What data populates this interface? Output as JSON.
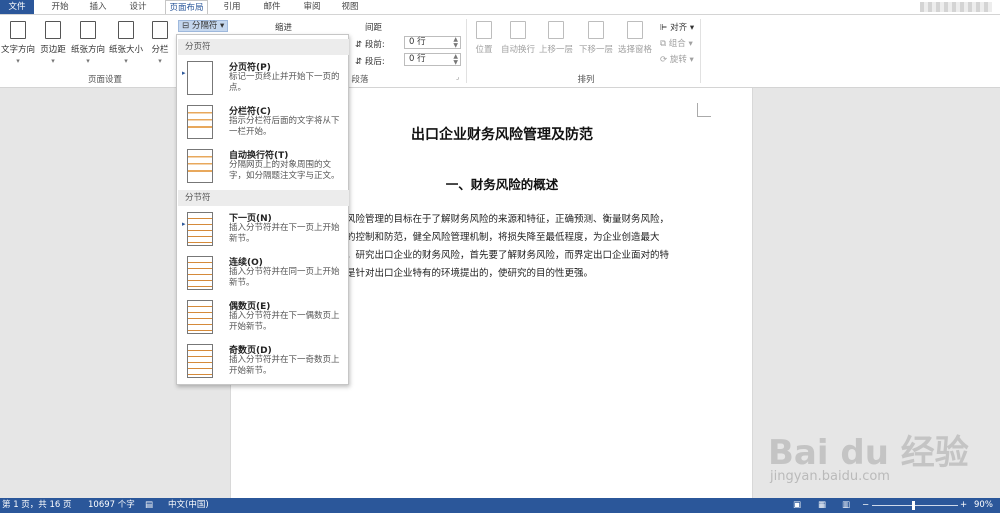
{
  "tabs": {
    "file": "文件",
    "home": "开始",
    "insert": "插入",
    "design": "设计",
    "layout": "页面布局",
    "references": "引用",
    "mailings": "邮件",
    "review": "审阅",
    "view": "视图"
  },
  "ribbon": {
    "text_direction": "文字方向",
    "margins": "页边距",
    "orientation": "纸张方向",
    "size": "纸张大小",
    "columns": "分栏",
    "breaks": "分隔符",
    "page_setup_label": "页面设置",
    "indent": "缩进",
    "spacing": "间距",
    "before_label": "段前:",
    "before_value": "0 行",
    "after_label": "段后:",
    "after_value": "0 行",
    "paragraph_label": "段落",
    "position": "位置",
    "wrap_text": "自动换行",
    "bring_forward": "上移一层",
    "send_backward": "下移一层",
    "selection_pane": "选择窗格",
    "align": "对齐",
    "group": "组合",
    "rotate": "旋转",
    "arrange_label": "排列"
  },
  "breaks_menu": {
    "page_breaks_header": "分页符",
    "section_breaks_header": "分节符",
    "items": [
      {
        "title": "分页符(P)",
        "desc": "标记一页终止并开始下一页的点。"
      },
      {
        "title": "分栏符(C)",
        "desc": "指示分栏符后面的文字将从下一栏开始。"
      },
      {
        "title": "自动换行符(T)",
        "desc": "分隔网页上的对象周围的文字，如分隔题注文字与正文。"
      },
      {
        "title": "下一页(N)",
        "desc": "插入分节符并在下一页上开始新节。"
      },
      {
        "title": "连续(O)",
        "desc": "插入分节符并在同一页上开始新节。"
      },
      {
        "title": "偶数页(E)",
        "desc": "插入分节符并在下一偶数页上开始新节。"
      },
      {
        "title": "奇数页(D)",
        "desc": "插入分节符并在下一奇数页上开始新节。"
      }
    ]
  },
  "document": {
    "title": "出口企业财务风险管理及防范",
    "heading1": "一、财务风险的概述",
    "lines": [
      "风险管理的目标在于了解财务风险的来源和特征，正确预测、衡量财务风险，",
      "的控制和防范，健全风险管理机制，将损失降至最低程度，为企业创造最大",
      "。研究出口企业的财务风险，首先要了解财务风险，而界定出口企业面对的特",
      "是针对出口企业特有的环境提出的，使研究的目的性更强。"
    ]
  },
  "status": {
    "page": "第 1 页，共 16 页",
    "words": "10697 个字",
    "language": "中文(中国)",
    "zoom_minus": "−",
    "zoom_plus": "+",
    "zoom": "90%"
  },
  "watermark": {
    "brand": "Bai du 经验",
    "url": "jingyan.baidu.com"
  },
  "colors": {
    "accent": "#2b579a",
    "thumb_orange": "#e8a85c"
  }
}
